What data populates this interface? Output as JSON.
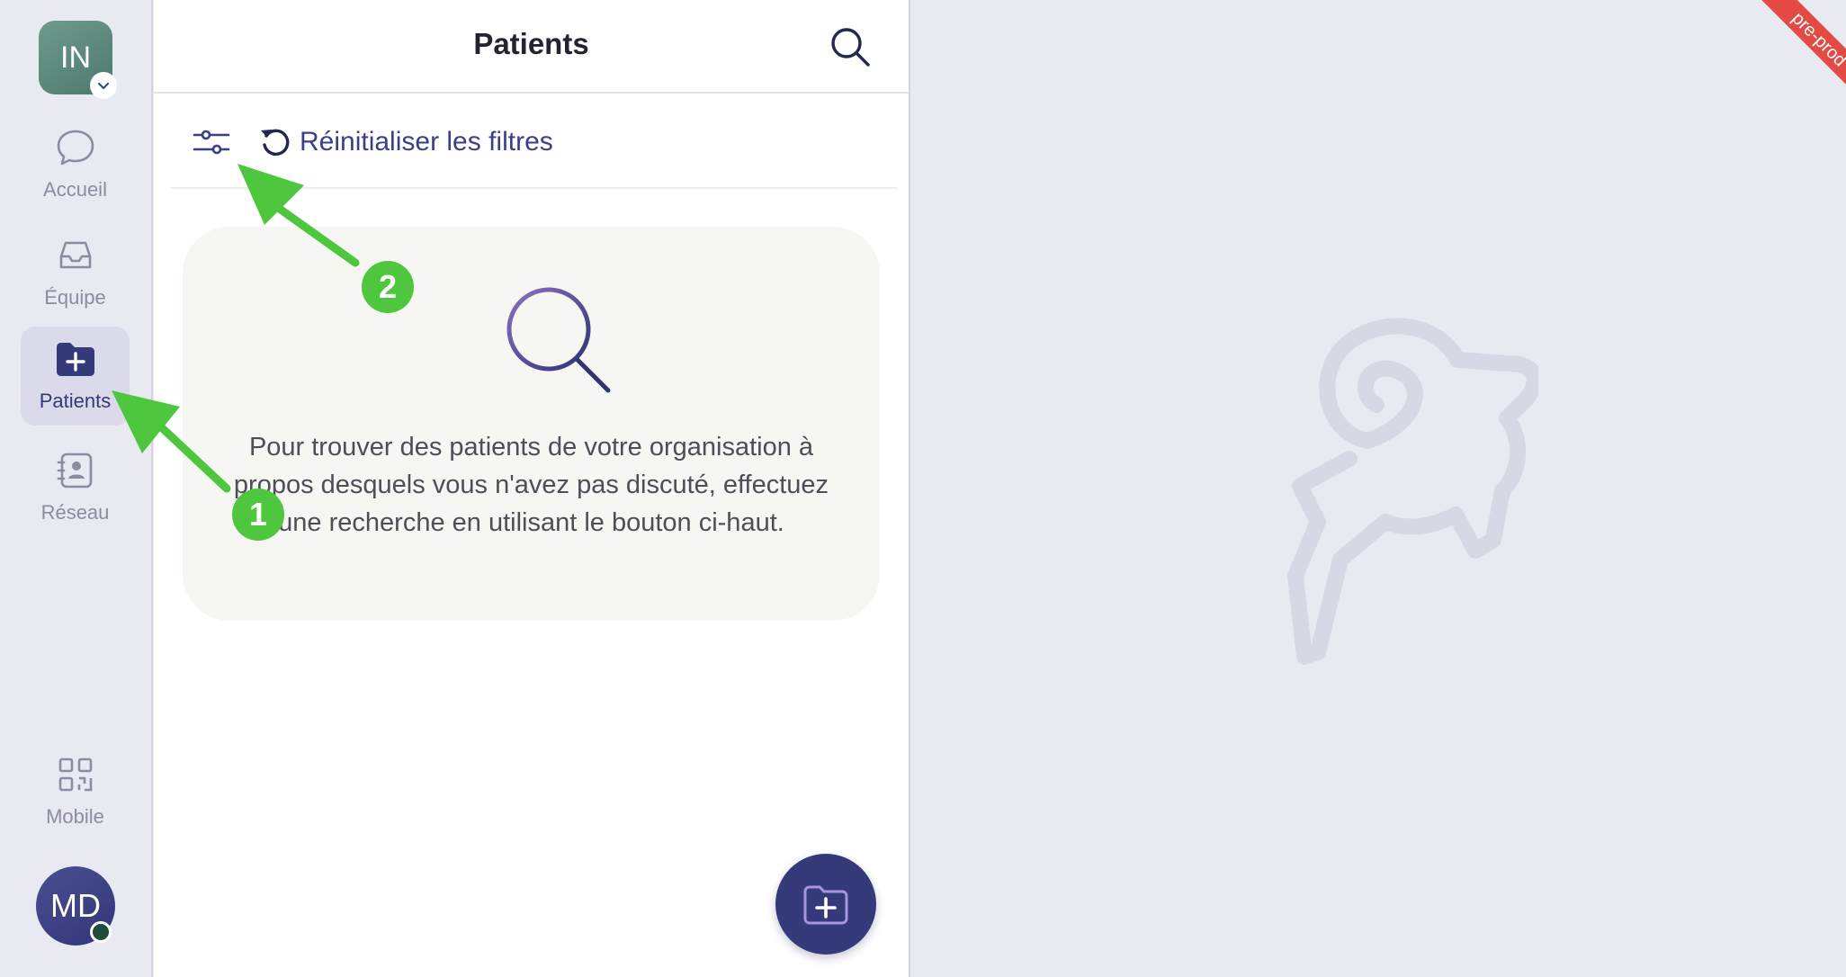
{
  "org": {
    "initials": "IN"
  },
  "nav": {
    "items": [
      {
        "label": "Accueil",
        "icon": "chat-bubble-icon",
        "active": false
      },
      {
        "label": "Équipe",
        "icon": "inbox-icon",
        "active": false
      },
      {
        "label": "Patients",
        "icon": "folder-plus-icon",
        "active": true
      },
      {
        "label": "Réseau",
        "icon": "contact-book-icon",
        "active": false
      }
    ],
    "mobile": {
      "label": "Mobile",
      "icon": "qr-code-icon"
    }
  },
  "user": {
    "initials": "MD",
    "status": "online"
  },
  "panel": {
    "title": "Patients",
    "reset_filters_label": "Réinitialiser les filtres",
    "empty_message": "Pour trouver des patients de votre organisation à propos desquels vous n'avez pas discuté, effectuez une recherche en utilisant le bouton ci-haut."
  },
  "environment_ribbon": "pre-prod",
  "annotations": {
    "marker_1": "1",
    "marker_2": "2"
  },
  "colors": {
    "accent": "#343a7a",
    "annotation": "#4ec63e",
    "ribbon": "#e24a43",
    "background": "#e9e9f2"
  }
}
